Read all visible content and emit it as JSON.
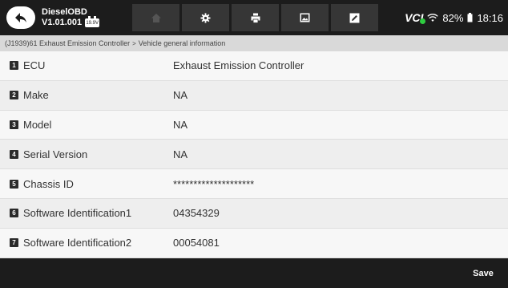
{
  "header": {
    "app_name": "DieselOBD",
    "app_version": "V1.01.001",
    "voltage_badge": "19.9V",
    "vci_label": "VCI",
    "battery_percent": "82%",
    "time": "18:16",
    "icons": [
      "back-arrow-icon",
      "home-icon",
      "settings-icon",
      "print-icon",
      "image-icon",
      "edit-icon",
      "wifi-icon",
      "battery-icon"
    ],
    "vci_status_color": "#2ecc40"
  },
  "breadcrumb": {
    "path": "(J1939)61 Exhaust Emission Controller",
    "separator": ">",
    "current": "Vehicle general information"
  },
  "rows": [
    {
      "index": "1",
      "label": "ECU",
      "value": "Exhaust Emission Controller"
    },
    {
      "index": "2",
      "label": "Make",
      "value": "NA"
    },
    {
      "index": "3",
      "label": "Model",
      "value": "NA"
    },
    {
      "index": "4",
      "label": "Serial Version",
      "value": "NA"
    },
    {
      "index": "5",
      "label": "Chassis ID",
      "value": "********************"
    },
    {
      "index": "6",
      "label": "Software Identification1",
      "value": "04354329"
    },
    {
      "index": "7",
      "label": "Software Identification2",
      "value": "00054081"
    }
  ],
  "footer": {
    "save_label": "Save"
  }
}
